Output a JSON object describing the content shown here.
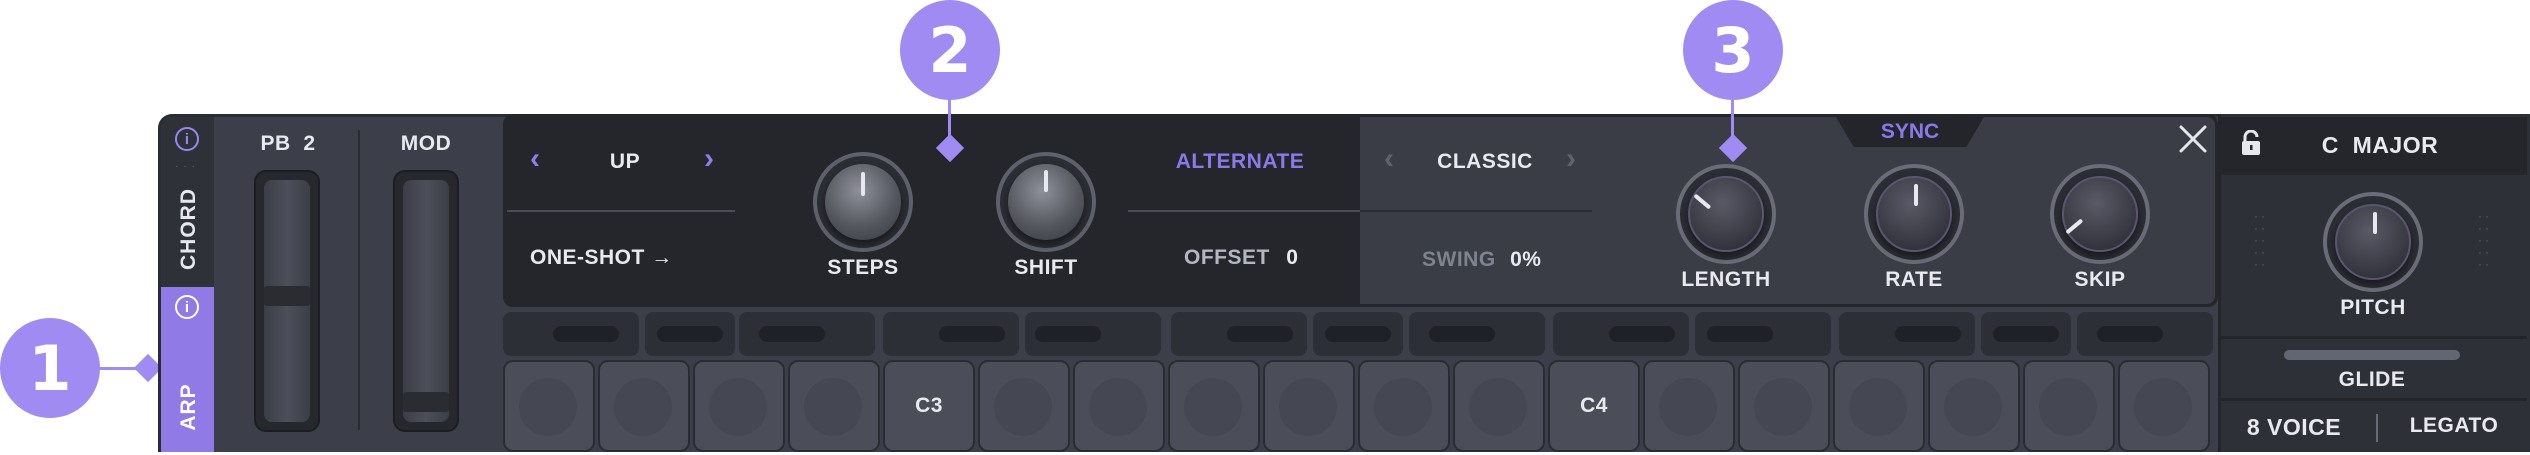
{
  "callouts": {
    "one": "1",
    "two": "2",
    "three": "3"
  },
  "tabs": {
    "chord": "CHORD",
    "arp": "ARP",
    "info_glyph": "i"
  },
  "wheels": {
    "pb": "PB  2",
    "mod": "MOD"
  },
  "arp": {
    "direction": "UP",
    "mode": "ONE-SHOT →",
    "steps_label": "STEPS",
    "shift_label": "SHIFT",
    "alternate": "ALTERNATE",
    "offset_label": "OFFSET",
    "offset_value": "0",
    "groove": "CLASSIC",
    "swing_label": "SWING",
    "swing_value": "0%",
    "sync": "SYNC",
    "length_label": "LENGTH",
    "rate_label": "RATE",
    "skip_label": "SKIP",
    "close_glyph": "✕"
  },
  "pads": {
    "c3": "C3",
    "c4": "C4"
  },
  "right": {
    "key": "C  MAJOR",
    "pitch_label": "PITCH",
    "glide_label": "GLIDE",
    "voices": "8 VOICE",
    "legato": "LEGATO"
  },
  "icons": [
    "lock-icon",
    "close-icon",
    "chevron-left-icon",
    "chevron-right-icon",
    "info-icon"
  ],
  "colors": {
    "accent": "#a08bf2",
    "panel": "#3c3f49",
    "dark": "#24262c"
  }
}
